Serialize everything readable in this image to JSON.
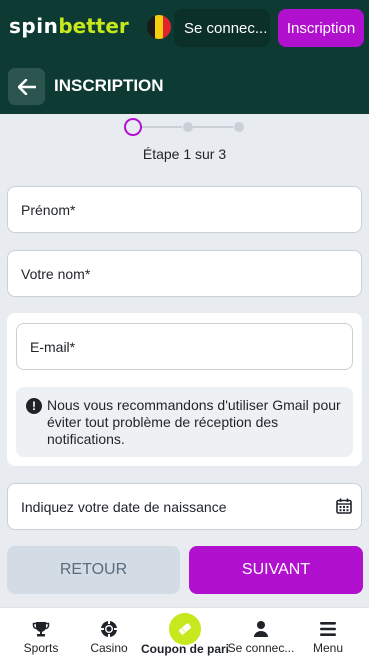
{
  "header": {
    "logo_part1": "spin",
    "logo_part2": "better",
    "login_label": "Se connec...",
    "signup_label": "Inscription",
    "flag_colors": [
      "#1a1a1a",
      "#f5cf0f",
      "#e2232c"
    ]
  },
  "titlebar": {
    "title": "INSCRIPTION"
  },
  "stepper": {
    "current": 1,
    "total": 3,
    "label": "Étape 1 sur 3"
  },
  "form": {
    "first_name_placeholder": "Prénom*",
    "last_name_placeholder": "Votre nom*",
    "email_placeholder": "E-mail*",
    "notice": "Nous vous recommandons d'utiliser Gmail pour éviter tout problème de réception des notifications.",
    "birthdate_placeholder": "Indiquez votre date de naissance"
  },
  "actions": {
    "back_label": "RETOUR",
    "next_label": "SUIVANT"
  },
  "bottom_nav": {
    "items": [
      {
        "label": "Sports",
        "icon": "trophy-icon"
      },
      {
        "label": "Casino",
        "icon": "casino-chip-icon"
      },
      {
        "label": "Coupon de pari",
        "icon": "ticket-icon"
      },
      {
        "label": "Se connec...",
        "icon": "user-icon"
      },
      {
        "label": "Menu",
        "icon": "hamburger-icon"
      }
    ]
  },
  "colors": {
    "header_bg": "#0d3b33",
    "accent": "#b210cf",
    "brand_lime": "#c6e81c"
  }
}
